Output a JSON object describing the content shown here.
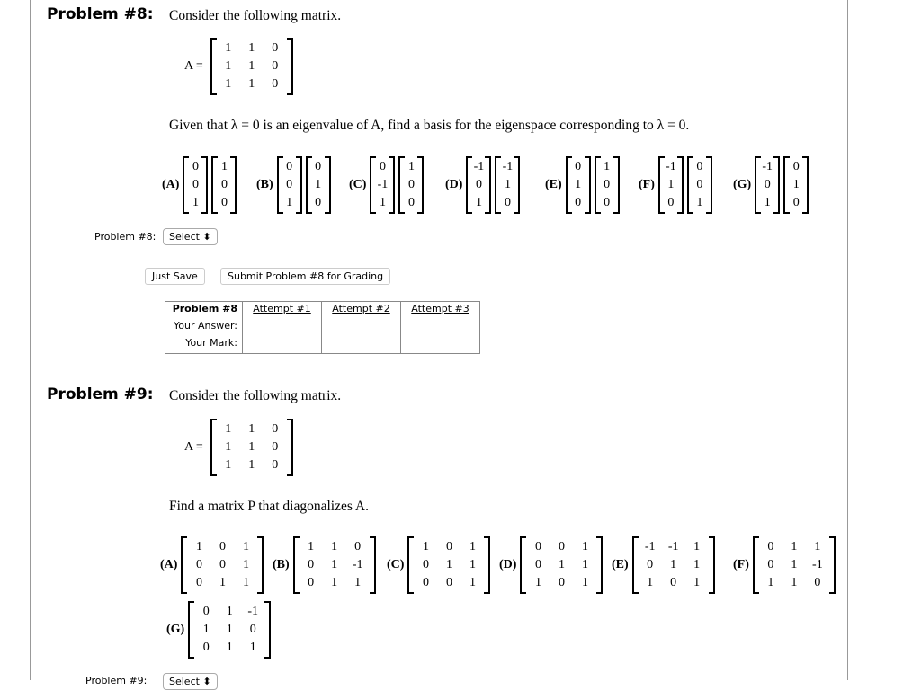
{
  "problem8": {
    "title": "Problem #8:",
    "intro": "Consider the following matrix.",
    "matrix_label": "A =",
    "matrix": [
      [
        "1",
        "1",
        "0"
      ],
      [
        "1",
        "1",
        "0"
      ],
      [
        "1",
        "1",
        "0"
      ]
    ],
    "question": "Given that λ = 0 is an eigenvalue of A, find a basis for the eigenspace corresponding to λ = 0.",
    "options": [
      {
        "label": "(A)",
        "vectors": [
          [
            "0",
            "0",
            "1"
          ],
          [
            "1",
            "0",
            "0"
          ]
        ]
      },
      {
        "label": "(B)",
        "vectors": [
          [
            "0",
            "0",
            "1"
          ],
          [
            "0",
            "1",
            "0"
          ]
        ]
      },
      {
        "label": "(C)",
        "vectors": [
          [
            "0",
            "-1",
            "1"
          ],
          [
            "1",
            "0",
            "0"
          ]
        ]
      },
      {
        "label": "(D)",
        "vectors": [
          [
            "-1",
            "0",
            "1"
          ],
          [
            "-1",
            "1",
            "0"
          ]
        ]
      },
      {
        "label": "(E)",
        "vectors": [
          [
            "0",
            "1",
            "0"
          ],
          [
            "1",
            "0",
            "0"
          ]
        ]
      },
      {
        "label": "(F)",
        "vectors": [
          [
            "-1",
            "1",
            "0"
          ],
          [
            "0",
            "0",
            "1"
          ]
        ]
      },
      {
        "label": "(G)",
        "vectors": [
          [
            "-1",
            "0",
            "1"
          ],
          [
            "0",
            "1",
            "0"
          ]
        ]
      }
    ],
    "answer_label": "Problem #8:",
    "select_value": "Select ⬍",
    "just_save": "Just Save",
    "submit": "Submit Problem #8 for Grading",
    "table": {
      "header": "Problem #8",
      "attempts": [
        "Attempt #1",
        "Attempt #2",
        "Attempt #3"
      ],
      "row_labels": [
        "Your Answer:",
        "Your Mark:"
      ]
    }
  },
  "problem9": {
    "title": "Problem #9:",
    "intro": "Consider the following matrix.",
    "matrix_label": "A =",
    "matrix": [
      [
        "1",
        "1",
        "0"
      ],
      [
        "1",
        "1",
        "0"
      ],
      [
        "1",
        "1",
        "0"
      ]
    ],
    "question": "Find a matrix P that diagonalizes A.",
    "options": [
      {
        "label": "(A)",
        "matrix": [
          [
            "1",
            "0",
            "1"
          ],
          [
            "0",
            "0",
            "1"
          ],
          [
            "0",
            "1",
            "1"
          ]
        ]
      },
      {
        "label": "(B)",
        "matrix": [
          [
            "1",
            "1",
            "0"
          ],
          [
            "0",
            "1",
            "-1"
          ],
          [
            "0",
            "1",
            "1"
          ]
        ]
      },
      {
        "label": "(C)",
        "matrix": [
          [
            "1",
            "0",
            "1"
          ],
          [
            "0",
            "1",
            "1"
          ],
          [
            "0",
            "0",
            "1"
          ]
        ]
      },
      {
        "label": "(D)",
        "matrix": [
          [
            "0",
            "0",
            "1"
          ],
          [
            "0",
            "1",
            "1"
          ],
          [
            "1",
            "0",
            "1"
          ]
        ]
      },
      {
        "label": "(E)",
        "matrix": [
          [
            "-1",
            "-1",
            "1"
          ],
          [
            "0",
            "1",
            "1"
          ],
          [
            "1",
            "0",
            "1"
          ]
        ]
      },
      {
        "label": "(F)",
        "matrix": [
          [
            "0",
            "1",
            "1"
          ],
          [
            "0",
            "1",
            "-1"
          ],
          [
            "1",
            "1",
            "0"
          ]
        ]
      },
      {
        "label": "(G)",
        "matrix": [
          [
            "0",
            "1",
            "-1"
          ],
          [
            "1",
            "1",
            "0"
          ],
          [
            "0",
            "1",
            "1"
          ]
        ]
      }
    ],
    "answer_label": "Problem #9:",
    "select_value": "Select ⬍"
  }
}
